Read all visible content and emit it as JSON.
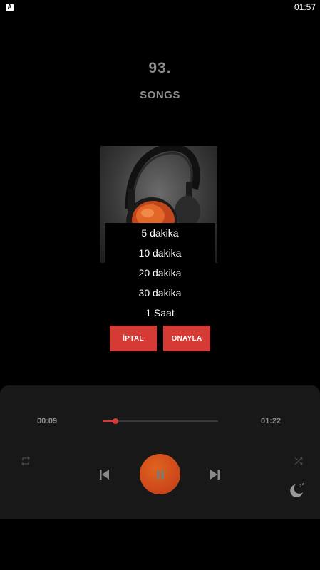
{
  "status_bar": {
    "app_icon_letter": "A",
    "time": "01:57"
  },
  "now_playing": {
    "track_number": "93.",
    "album": "SONGS"
  },
  "sleep_timer": {
    "options": [
      "5 dakika",
      "10 dakika",
      "20 dakika",
      "30 dakika",
      "1 Saat"
    ],
    "cancel_label": "İPTAL",
    "confirm_label": "ONAYLA"
  },
  "player": {
    "elapsed": "00:09",
    "total": "01:22",
    "progress_fraction": 0.11
  },
  "colors": {
    "accent": "#d53a35",
    "play_button": "#d9561d",
    "muted_text": "#8d8d8d",
    "panel_bg": "#181818"
  },
  "icons": {
    "repeat": "repeat-icon",
    "shuffle": "shuffle-icon",
    "previous": "skip-previous-icon",
    "play_pause": "pause-icon",
    "next": "skip-next-icon",
    "sleep": "sleep-timer-icon"
  }
}
